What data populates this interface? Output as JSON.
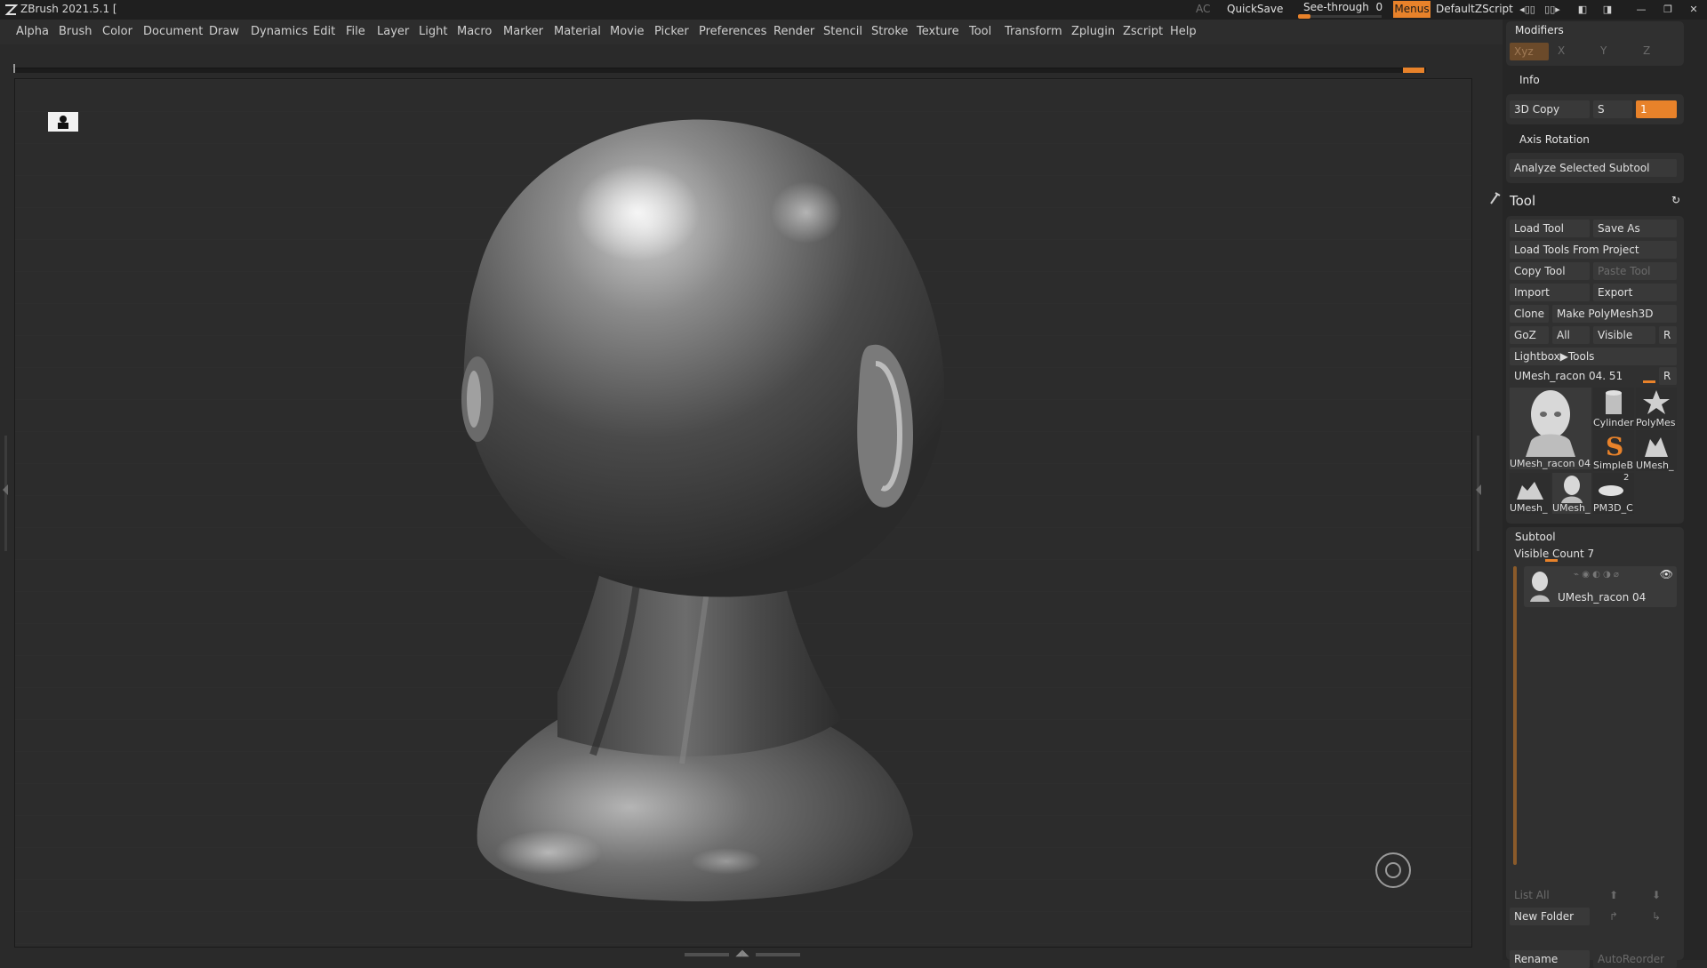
{
  "titlebar": {
    "title": "ZBrush 2021.5.1 [",
    "ac": "AC",
    "quicksave": "QuickSave",
    "seethrough_label": "See-through",
    "seethrough_value": "0",
    "seethrough_level": 0,
    "menus": "Menus",
    "default_zscript": "DefaultZScript"
  },
  "menu": {
    "items": [
      "Alpha",
      "Brush",
      "Color",
      "Document",
      "Draw",
      "Dynamics",
      "Edit",
      "File",
      "Layer",
      "Light",
      "Macro",
      "Marker",
      "Material",
      "Movie",
      "Picker",
      "Preferences",
      "Render",
      "Stencil",
      "Stroke",
      "Texture",
      "Tool",
      "Transform",
      "Zplugin",
      "Zscript",
      "Help"
    ]
  },
  "palette": {
    "modifiers": {
      "title": "Modifiers",
      "xyz": "Xyz",
      "x": "X",
      "y": "Y",
      "z": "Z"
    },
    "info": "Info",
    "copy3d": {
      "label": "3D Copy",
      "s": "S",
      "value": "1"
    },
    "axis_rotation": "Axis Rotation",
    "analyze": "Analyze Selected Subtool",
    "tool": {
      "title": "Tool",
      "load_tool": "Load Tool",
      "save_as": "Save As",
      "load_from_project": "Load Tools From Project",
      "copy_tool": "Copy Tool",
      "paste_tool": "Paste Tool",
      "import": "Import",
      "export": "Export",
      "clone": "Clone",
      "make_polymesh": "Make PolyMesh3D",
      "goz": "GoZ",
      "all": "All",
      "visible": "Visible",
      "r": "R",
      "lightbox_tools": "Lightbox▶Tools",
      "current_tool": "UMesh_racon 04. 51",
      "thumbs": [
        "UMesh_racon 04",
        "Cylinder",
        "PolyMes",
        "SimpleB",
        "UMesh_",
        "UMesh_",
        "UMesh_",
        "PM3D_C"
      ],
      "pm3d_count": "2"
    },
    "subtool": {
      "title": "Subtool",
      "visible_count": "Visible Count 7",
      "item": "UMesh_racon 04",
      "list_all": "List All",
      "new_folder": "New Folder",
      "rename": "Rename",
      "autoreorder": "AutoReorder"
    }
  },
  "colors": {
    "accent": "#e8822a",
    "panel": "#303030",
    "canvas": "#2c2c2c"
  }
}
